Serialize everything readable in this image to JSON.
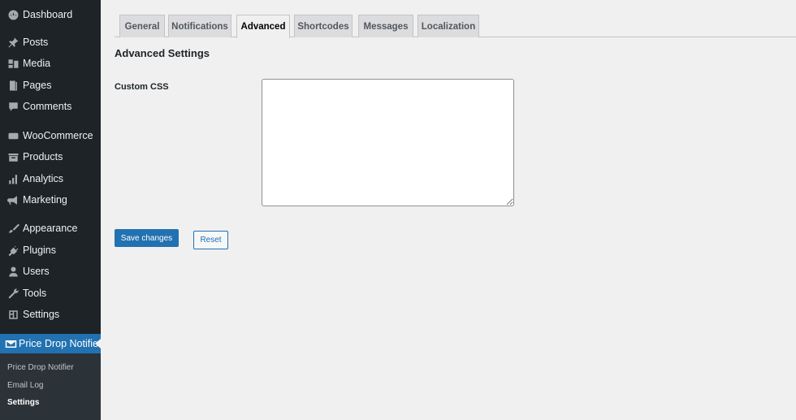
{
  "sidebar": {
    "items": [
      {
        "label": "Dashboard",
        "icon": "dashboard-icon"
      },
      {
        "label": "Posts",
        "icon": "pin-icon"
      },
      {
        "label": "Media",
        "icon": "media-icon"
      },
      {
        "label": "Pages",
        "icon": "pages-icon"
      },
      {
        "label": "Comments",
        "icon": "comment-icon"
      },
      {
        "label": "WooCommerce",
        "icon": "woo-icon"
      },
      {
        "label": "Products",
        "icon": "archive-icon"
      },
      {
        "label": "Analytics",
        "icon": "bar-chart-icon"
      },
      {
        "label": "Marketing",
        "icon": "megaphone-icon"
      },
      {
        "label": "Appearance",
        "icon": "brush-icon"
      },
      {
        "label": "Plugins",
        "icon": "plug-icon"
      },
      {
        "label": "Users",
        "icon": "user-icon"
      },
      {
        "label": "Tools",
        "icon": "wrench-icon"
      },
      {
        "label": "Settings",
        "icon": "settings-icon"
      },
      {
        "label": "Price Drop Notifier",
        "icon": "mail-tag-icon"
      }
    ],
    "submenu": [
      {
        "label": "Price Drop Notifier"
      },
      {
        "label": "Email Log"
      },
      {
        "label": "Settings"
      }
    ],
    "accent_color": "#2271b1"
  },
  "tabs": [
    {
      "label": "General"
    },
    {
      "label": "Notifications"
    },
    {
      "label": "Advanced"
    },
    {
      "label": "Shortcodes"
    },
    {
      "label": "Messages"
    },
    {
      "label": "Localization"
    }
  ],
  "active_tab": "Advanced",
  "section": {
    "title": "Advanced Settings",
    "field_label": "Custom CSS",
    "field_value": ""
  },
  "buttons": {
    "save_label": "Save changes",
    "reset_label": "Reset"
  }
}
